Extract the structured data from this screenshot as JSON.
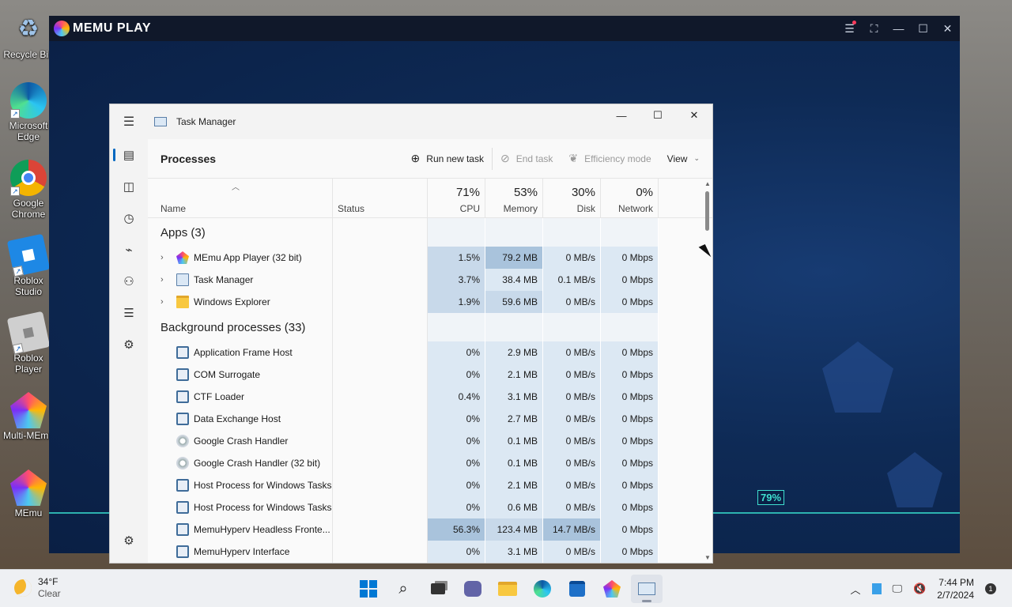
{
  "desktop_icons": [
    {
      "label": "Recycle Bin",
      "icon": "recycle-bin-icon"
    },
    {
      "label": "Microsoft Edge",
      "icon": "edge-icon"
    },
    {
      "label": "Google Chrome",
      "icon": "chrome-icon"
    },
    {
      "label": "Roblox Studio",
      "icon": "roblox-studio-icon"
    },
    {
      "label": "Roblox Player",
      "icon": "roblox-player-icon"
    },
    {
      "label": "Multi-MEmu",
      "icon": "multi-memu-icon"
    },
    {
      "label": "MEmu",
      "icon": "memu-icon"
    }
  ],
  "memu": {
    "title": "MEMU PLAY",
    "progress_label": "79%",
    "progress_value": 79
  },
  "task_manager": {
    "title": "Task Manager",
    "page_title": "Processes",
    "toolbar": {
      "run_new_task": "Run new task",
      "end_task": "End task",
      "efficiency_mode": "Efficiency mode",
      "view": "View"
    },
    "columns": {
      "name": "Name",
      "status": "Status",
      "cpu": {
        "label": "CPU",
        "pct": "71%"
      },
      "memory": {
        "label": "Memory",
        "pct": "53%"
      },
      "disk": {
        "label": "Disk",
        "pct": "30%"
      },
      "network": {
        "label": "Network",
        "pct": "0%"
      }
    },
    "groups": {
      "apps": "Apps (3)",
      "background": "Background processes (33)"
    },
    "apps": [
      {
        "name": "MEmu App Player (32 bit)",
        "icon": "memu-icon",
        "cpu": "1.5%",
        "memory": "79.2 MB",
        "disk": "0 MB/s",
        "network": "0 Mbps",
        "heat": [
          "h2",
          "h3",
          "h1",
          "h1"
        ]
      },
      {
        "name": "Task Manager",
        "icon": "task-manager-icon",
        "cpu": "3.7%",
        "memory": "38.4 MB",
        "disk": "0.1 MB/s",
        "network": "0 Mbps",
        "heat": [
          "h2",
          "h1",
          "h1",
          "h1"
        ]
      },
      {
        "name": "Windows Explorer",
        "icon": "folder-icon",
        "cpu": "1.9%",
        "memory": "59.6 MB",
        "disk": "0 MB/s",
        "network": "0 Mbps",
        "heat": [
          "h2",
          "h2",
          "h1",
          "h1"
        ]
      }
    ],
    "background": [
      {
        "name": "Application Frame Host",
        "icon": "process-icon",
        "cpu": "0%",
        "memory": "2.9 MB",
        "disk": "0 MB/s",
        "network": "0 Mbps",
        "heat": [
          "h1",
          "h1",
          "h1",
          "h1"
        ]
      },
      {
        "name": "COM Surrogate",
        "icon": "process-icon",
        "cpu": "0%",
        "memory": "2.1 MB",
        "disk": "0 MB/s",
        "network": "0 Mbps",
        "heat": [
          "h1",
          "h1",
          "h1",
          "h1"
        ]
      },
      {
        "name": "CTF Loader",
        "icon": "process-icon",
        "cpu": "0.4%",
        "memory": "3.1 MB",
        "disk": "0 MB/s",
        "network": "0 Mbps",
        "heat": [
          "h1",
          "h1",
          "h1",
          "h1"
        ]
      },
      {
        "name": "Data Exchange Host",
        "icon": "process-icon",
        "cpu": "0%",
        "memory": "2.7 MB",
        "disk": "0 MB/s",
        "network": "0 Mbps",
        "heat": [
          "h1",
          "h1",
          "h1",
          "h1"
        ]
      },
      {
        "name": "Google Crash Handler",
        "icon": "crash-handler-icon",
        "cpu": "0%",
        "memory": "0.1 MB",
        "disk": "0 MB/s",
        "network": "0 Mbps",
        "heat": [
          "h1",
          "h1",
          "h1",
          "h1"
        ]
      },
      {
        "name": "Google Crash Handler (32 bit)",
        "icon": "crash-handler-icon",
        "cpu": "0%",
        "memory": "0.1 MB",
        "disk": "0 MB/s",
        "network": "0 Mbps",
        "heat": [
          "h1",
          "h1",
          "h1",
          "h1"
        ]
      },
      {
        "name": "Host Process for Windows Tasks",
        "icon": "process-icon",
        "cpu": "0%",
        "memory": "2.1 MB",
        "disk": "0 MB/s",
        "network": "0 Mbps",
        "heat": [
          "h1",
          "h1",
          "h1",
          "h1"
        ]
      },
      {
        "name": "Host Process for Windows Tasks",
        "icon": "process-icon",
        "cpu": "0%",
        "memory": "0.6 MB",
        "disk": "0 MB/s",
        "network": "0 Mbps",
        "heat": [
          "h1",
          "h1",
          "h1",
          "h1"
        ]
      },
      {
        "name": "MemuHyperv Headless Fronte...",
        "icon": "process-icon",
        "cpu": "56.3%",
        "memory": "123.4 MB",
        "disk": "14.7 MB/s",
        "network": "0 Mbps",
        "heat": [
          "h3",
          "h2",
          "h3",
          "h1"
        ]
      },
      {
        "name": "MemuHyperv Interface",
        "icon": "process-icon",
        "cpu": "0%",
        "memory": "3.1 MB",
        "disk": "0 MB/s",
        "network": "0 Mbps",
        "heat": [
          "h1",
          "h1",
          "h1",
          "h1"
        ]
      }
    ]
  },
  "taskbar": {
    "temperature": "34°F",
    "condition": "Clear",
    "time": "7:44 PM",
    "date": "2/7/2024",
    "notification_count": "1"
  },
  "colors": {
    "accent": "#0067c0",
    "memu_bg": "#0f2a52",
    "heat_low": "#dce8f3",
    "heat_mid": "#c8d9ea",
    "heat_high": "#a9c3dc"
  }
}
